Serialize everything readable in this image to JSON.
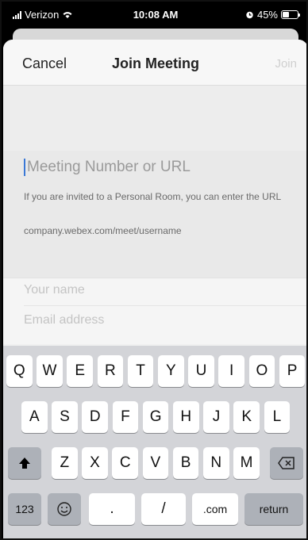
{
  "status_bar": {
    "carrier": "Verizon",
    "time": "10:08 AM",
    "battery_percent": "45%",
    "battery_level": 0.45
  },
  "nav": {
    "cancel_label": "Cancel",
    "title": "Join Meeting",
    "join_label": "Join"
  },
  "meeting": {
    "placeholder": "Meeting Number or URL",
    "hint": "If you are invited to a Personal Room, you can enter the URL",
    "example_url": "company.webex.com/meet/username"
  },
  "identity": {
    "name_placeholder": "Your name",
    "email_placeholder": "Email address"
  },
  "keyboard": {
    "row1": [
      "Q",
      "W",
      "E",
      "R",
      "T",
      "Y",
      "U",
      "I",
      "O",
      "P"
    ],
    "row2": [
      "A",
      "S",
      "D",
      "F",
      "G",
      "H",
      "J",
      "K",
      "L"
    ],
    "row3": [
      "Z",
      "X",
      "C",
      "V",
      "B",
      "N",
      "M"
    ],
    "numbers_label": "123",
    "dot_label": ".",
    "slash_label": "/",
    "dotcom_label": ".com",
    "return_label": "return",
    "shift_icon": "shift-arrow-icon",
    "delete_icon": "backspace-icon",
    "emoji_icon": "emoji-icon"
  }
}
